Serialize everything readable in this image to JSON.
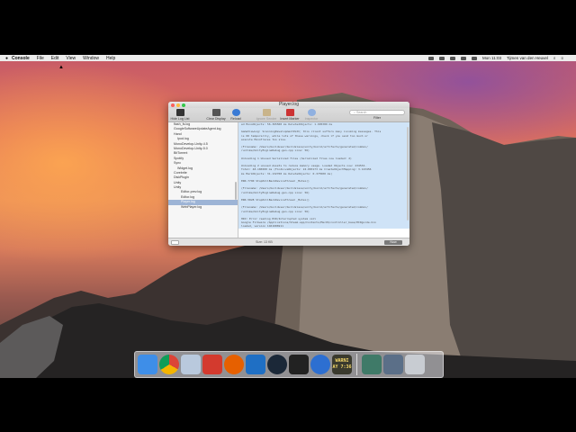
{
  "menubar": {
    "app_name": "Console",
    "items": [
      "File",
      "Edit",
      "View",
      "Window",
      "Help"
    ],
    "clock": "Mon 11:03",
    "user": "Tijmen van den Heuvel"
  },
  "window": {
    "title": "Player.log",
    "toolbar": {
      "hide_log_list": "Hide Log List",
      "clear_display": "Clear Display",
      "reload": "Reload",
      "ignore_sender": "Ignore Sender",
      "insert_marker": "Insert Marker",
      "inspector": "Inspector",
      "search_placeholder": "Search",
      "filter_label": "Filter"
    },
    "sidebar": [
      "flash_fs.log",
      "GoogleSoftwareUpdateAgent.log",
      "Hand",
      "Ipod.log",
      "MonoDevelop-Unity-4.5",
      "MonoDevelop-Unity-5.0",
      "BitTorrent",
      "Spotify",
      "Sync",
      "Widget.log",
      "Corebrite",
      "DiskPlugin",
      "Unity",
      "Unity",
      "Editor-prev.log",
      "Editor.log",
      "Player.log",
      "WebPlayer.log"
    ],
    "selected_index": 16,
    "log_lines": [
      "ed MonoObjects: 56.365500 ms  DeletedObjects: 1.995389 ms",
      "",
      "GameViewLog: ScanningDevelopmentPath; this client suffers many incoming messages. This",
      "is OK temporarily, while lots of these warnings, check if you send too much or",
      "execute MonoTraces too slow.",
      "",
      "(Filename: /Users/builduser/buildslave/unity/build/artifacts/generated/common/",
      "runtime/UnityEngineDebug.gen.cpp Line: 56)",
      "",
      "Unloading 1 Unused Serialized files (Serialized files now loaded: 2)",
      "",
      "Unloading 2 unused Assets to reduce memory usage. Loaded Objects now: 234532.",
      "Total: 48.186500 ms (FindLiveObjects: 24.083173 ms CreateObjectMapping: 3.123456",
      "ms MarkObjects: 31.132700 ms  DeleteObjects: 0.375500 ms)",
      "",
      "ERR.7790 StopPollBackDeviceThread _Mutex()",
      "",
      "(Filename: /Users/builduser/buildslave/unity/build/artifacts/generated/common/",
      "runtime/UnityEngineDebug.gen.cpp Line: 56)",
      "",
      "ERR.5828 StopPollBackDeviceThread _Mutex()",
      "",
      "(Filename: /Users/builduser/buildslave/unity/build/artifacts/generated/common/",
      "runtime/UnityEngineDebug.gen.cpp Line: 56)",
      "",
      "HID: Error reading HID/Interrupted system call",
      "Google Firmware /Applications/Steam.app/Contents/MacOS/controller_base/HIDguide.bin",
      "loaded, version 1461686911"
    ],
    "status_size": "Size: 13 KB",
    "now_label": "Now"
  },
  "dock": [
    {
      "name": "finder-icon",
      "color": "#3e8ee8"
    },
    {
      "name": "chrome-icon",
      "color": "#e0e0e0"
    },
    {
      "name": "network-utility-icon",
      "color": "#b9c9dd"
    },
    {
      "name": "parallels-icon",
      "color": "#d33a2e"
    },
    {
      "name": "firefox-icon",
      "color": "#e66000"
    },
    {
      "name": "visual-studio-code-icon",
      "color": "#1f6fc4"
    },
    {
      "name": "steam-icon",
      "color": "#1b2838"
    },
    {
      "name": "terminal-icon",
      "color": "#222222"
    },
    {
      "name": "quicktime-icon",
      "color": "#2d6fd1"
    },
    {
      "name": "console-icon",
      "color": "#3a3a2e"
    },
    {
      "name": "desktop-thumbnail-icon",
      "color": "#3f7a68"
    },
    {
      "name": "window-thumbnail-icon",
      "color": "#5b6f88"
    },
    {
      "name": "trash-icon",
      "color": "#c8ccd2"
    }
  ],
  "dock_text": {
    "console_glyph": "WARNI\nAY 7:36"
  },
  "colors": {
    "selection": "#9db4d6",
    "log_highlight": "#cfe3f7"
  }
}
